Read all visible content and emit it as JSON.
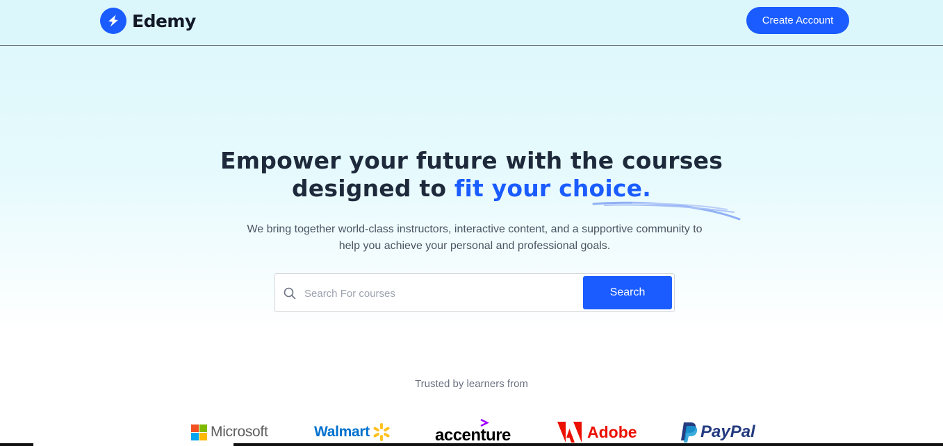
{
  "navbar": {
    "brand": "Edemy",
    "create_account_label": "Create Account"
  },
  "hero": {
    "title_line1": "Empower your future with the courses",
    "title_line2_prefix": "designed to ",
    "title_line2_accent": "fit your choice.",
    "subtitle": "We bring together world-class instructors, interactive content, and a supportive community to help you achieve your personal and professional goals."
  },
  "search": {
    "placeholder": "Search For courses",
    "button_label": "Search"
  },
  "trusted": {
    "label": "Trusted by learners from",
    "companies": [
      "Microsoft",
      "Walmart",
      "accenture",
      "Adobe",
      "PayPal"
    ]
  },
  "icons": {
    "logo": "lightning-bolt-icon",
    "search": "search-icon"
  },
  "colors": {
    "accent": "#1a5cff",
    "heading": "#1e2a3b",
    "background_top": "#dcf7fb"
  }
}
